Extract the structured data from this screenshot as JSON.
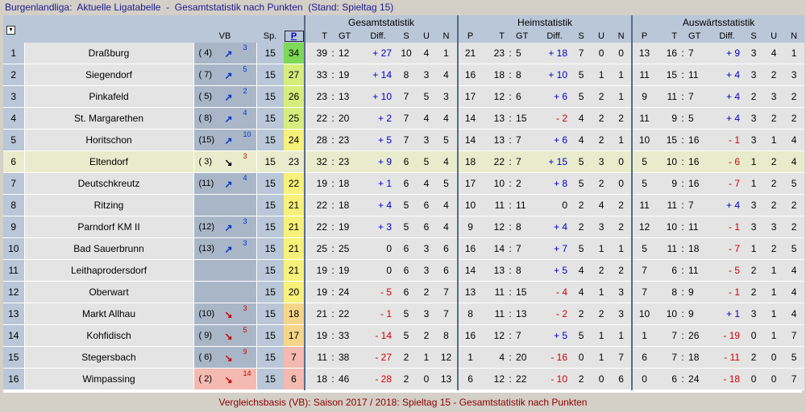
{
  "title_line": "Burgenlandliga:  Aktuelle Ligatabelle  -  Gesamtstatistik nach Punkten  (Stand: Spieltag 15)",
  "footer": "Vergleichsbasis (VB): Saison 2017 / 2018: Spieltag 15 - Gesamtstatistik nach Punkten",
  "headers": {
    "vb": "VB",
    "sp": "Sp.",
    "p": "P",
    "gesamt": "Gesamtstatistik",
    "heim": "Heimstatistik",
    "aus": "Auswärtsstatistik",
    "gesamt_cols": [
      "T",
      "GT",
      "Diff.",
      "S",
      "U",
      "N"
    ],
    "heim_cols": [
      "P",
      "T",
      "GT",
      "Diff.",
      "S",
      "U",
      "N"
    ],
    "aus_cols": [
      "P",
      "T",
      "GT",
      "Diff.",
      "S",
      "U",
      "N"
    ],
    "sort_icon": "▾"
  },
  "colors": {
    "p_green": "#7ed957",
    "p_yellow_green": "#d8ec7e",
    "p_yellow": "#f7f07a",
    "p_orange": "#f6d58a",
    "p_red": "#f4b9b1",
    "highlight": "#e8eccc"
  },
  "rows": [
    {
      "rank": "1",
      "team": "Draßburg",
      "vb": "( 4)",
      "dir": "up",
      "chg": "3",
      "sp": "15",
      "p": "34",
      "g": [
        "39",
        "12",
        "+ 27",
        "10",
        "4",
        "1"
      ],
      "h": [
        "21",
        "23",
        "5",
        "+ 18",
        "7",
        "0",
        "0"
      ],
      "a": [
        "13",
        "16",
        "7",
        "+  9",
        "3",
        "4",
        "1"
      ]
    },
    {
      "rank": "2",
      "team": "Siegendorf",
      "vb": "( 7)",
      "dir": "up",
      "chg": "5",
      "sp": "15",
      "p": "27",
      "g": [
        "33",
        "19",
        "+ 14",
        "8",
        "3",
        "4"
      ],
      "h": [
        "16",
        "18",
        "8",
        "+ 10",
        "5",
        "1",
        "1"
      ],
      "a": [
        "11",
        "15",
        "11",
        "+  4",
        "3",
        "2",
        "3"
      ]
    },
    {
      "rank": "3",
      "team": "Pinkafeld",
      "vb": "( 5)",
      "dir": "up",
      "chg": "2",
      "sp": "15",
      "p": "26",
      "g": [
        "23",
        "13",
        "+ 10",
        "7",
        "5",
        "3"
      ],
      "h": [
        "17",
        "12",
        "6",
        "+  6",
        "5",
        "2",
        "1"
      ],
      "a": [
        "9",
        "11",
        "7",
        "+  4",
        "2",
        "3",
        "2"
      ]
    },
    {
      "rank": "4",
      "team": "St. Margarethen",
      "vb": "( 8)",
      "dir": "up",
      "chg": "4",
      "sp": "15",
      "p": "25",
      "g": [
        "22",
        "20",
        "+  2",
        "7",
        "4",
        "4"
      ],
      "h": [
        "14",
        "13",
        "15",
        "-  2",
        "4",
        "2",
        "2"
      ],
      "a": [
        "11",
        "9",
        "5",
        "+  4",
        "3",
        "2",
        "2"
      ]
    },
    {
      "rank": "5",
      "team": "Horitschon",
      "vb": "(15)",
      "dir": "up",
      "chg": "10",
      "sp": "15",
      "p": "24",
      "g": [
        "28",
        "23",
        "+  5",
        "7",
        "3",
        "5"
      ],
      "h": [
        "14",
        "13",
        "7",
        "+  6",
        "4",
        "2",
        "1"
      ],
      "a": [
        "10",
        "15",
        "16",
        "-  1",
        "3",
        "1",
        "4"
      ]
    },
    {
      "rank": "6",
      "team": "Eltendorf",
      "vb": "( 3)",
      "dir": "downblack",
      "chg": "3",
      "sp": "15",
      "p": "23",
      "g": [
        "32",
        "23",
        "+  9",
        "6",
        "5",
        "4"
      ],
      "h": [
        "18",
        "22",
        "7",
        "+ 15",
        "5",
        "3",
        "0"
      ],
      "a": [
        "5",
        "10",
        "16",
        "-  6",
        "1",
        "2",
        "4"
      ],
      "hl": true
    },
    {
      "rank": "7",
      "team": "Deutschkreutz",
      "vb": "(11)",
      "dir": "up",
      "chg": "4",
      "sp": "15",
      "p": "22",
      "g": [
        "19",
        "18",
        "+  1",
        "6",
        "4",
        "5"
      ],
      "h": [
        "17",
        "10",
        "2",
        "+  8",
        "5",
        "2",
        "0"
      ],
      "a": [
        "5",
        "9",
        "16",
        "-  7",
        "1",
        "2",
        "5"
      ]
    },
    {
      "rank": "8",
      "team": "Ritzing",
      "vb": "",
      "dir": "",
      "chg": "",
      "sp": "15",
      "p": "21",
      "g": [
        "22",
        "18",
        "+  4",
        "5",
        "6",
        "4"
      ],
      "h": [
        "10",
        "11",
        "11",
        "0",
        "2",
        "4",
        "2"
      ],
      "a": [
        "11",
        "11",
        "7",
        "+  4",
        "3",
        "2",
        "2"
      ]
    },
    {
      "rank": "9",
      "team": "Parndorf KM II",
      "vb": "(12)",
      "dir": "up",
      "chg": "3",
      "sp": "15",
      "p": "21",
      "g": [
        "22",
        "19",
        "+  3",
        "5",
        "6",
        "4"
      ],
      "h": [
        "9",
        "12",
        "8",
        "+  4",
        "2",
        "3",
        "2"
      ],
      "a": [
        "12",
        "10",
        "11",
        "-  1",
        "3",
        "3",
        "2"
      ]
    },
    {
      "rank": "10",
      "team": "Bad Sauerbrunn",
      "vb": "(13)",
      "dir": "up",
      "chg": "3",
      "sp": "15",
      "p": "21",
      "g": [
        "25",
        "25",
        "0",
        "6",
        "3",
        "6"
      ],
      "h": [
        "16",
        "14",
        "7",
        "+  7",
        "5",
        "1",
        "1"
      ],
      "a": [
        "5",
        "11",
        "18",
        "-  7",
        "1",
        "2",
        "5"
      ]
    },
    {
      "rank": "11",
      "team": "Leithaprodersdorf",
      "vb": "",
      "dir": "",
      "chg": "",
      "sp": "15",
      "p": "21",
      "g": [
        "19",
        "19",
        "0",
        "6",
        "3",
        "6"
      ],
      "h": [
        "14",
        "13",
        "8",
        "+  5",
        "4",
        "2",
        "2"
      ],
      "a": [
        "7",
        "6",
        "11",
        "-  5",
        "2",
        "1",
        "4"
      ]
    },
    {
      "rank": "12",
      "team": "Oberwart",
      "vb": "",
      "dir": "",
      "chg": "",
      "sp": "15",
      "p": "20",
      "g": [
        "19",
        "24",
        "-  5",
        "6",
        "2",
        "7"
      ],
      "h": [
        "13",
        "11",
        "15",
        "-  4",
        "4",
        "1",
        "3"
      ],
      "a": [
        "7",
        "8",
        "9",
        "-  1",
        "2",
        "1",
        "4"
      ]
    },
    {
      "rank": "13",
      "team": "Markt Allhau",
      "vb": "(10)",
      "dir": "down",
      "chg": "3",
      "sp": "15",
      "p": "18",
      "g": [
        "21",
        "22",
        "-  1",
        "5",
        "3",
        "7"
      ],
      "h": [
        "8",
        "11",
        "13",
        "-  2",
        "2",
        "2",
        "3"
      ],
      "a": [
        "10",
        "10",
        "9",
        "+  1",
        "3",
        "1",
        "4"
      ]
    },
    {
      "rank": "14",
      "team": "Kohfidisch",
      "vb": "( 9)",
      "dir": "down",
      "chg": "5",
      "sp": "15",
      "p": "17",
      "g": [
        "19",
        "33",
        "- 14",
        "5",
        "2",
        "8"
      ],
      "h": [
        "16",
        "12",
        "7",
        "+  5",
        "5",
        "1",
        "1"
      ],
      "a": [
        "1",
        "7",
        "26",
        "- 19",
        "0",
        "1",
        "7"
      ]
    },
    {
      "rank": "15",
      "team": "Stegersbach",
      "vb": "( 6)",
      "dir": "down",
      "chg": "9",
      "sp": "15",
      "p": "7",
      "g": [
        "11",
        "38",
        "- 27",
        "2",
        "1",
        "12"
      ],
      "h": [
        "1",
        "4",
        "20",
        "- 16",
        "0",
        "1",
        "7"
      ],
      "a": [
        "6",
        "7",
        "18",
        "- 11",
        "2",
        "0",
        "5"
      ]
    },
    {
      "rank": "16",
      "team": "Wimpassing",
      "vb": "( 2)",
      "dir": "down",
      "chg": "14",
      "sp": "15",
      "p": "6",
      "g": [
        "18",
        "46",
        "- 28",
        "2",
        "0",
        "13"
      ],
      "h": [
        "6",
        "12",
        "22",
        "- 10",
        "2",
        "0",
        "6"
      ],
      "a": [
        "0",
        "6",
        "24",
        "- 18",
        "0",
        "0",
        "7"
      ],
      "vbred": true
    }
  ]
}
